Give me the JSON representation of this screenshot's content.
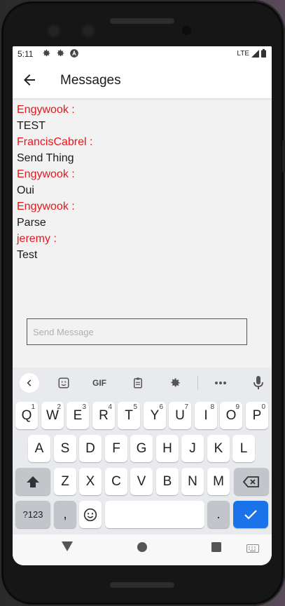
{
  "status": {
    "time": "5:11",
    "network": "LTE"
  },
  "appbar": {
    "title": "Messages"
  },
  "messages": [
    {
      "author": "Engywook :",
      "text": "TEST"
    },
    {
      "author": "FrancisCabrel :",
      "text": "Send Thing"
    },
    {
      "author": "Engywook :",
      "text": "Oui"
    },
    {
      "author": "Engywook :",
      "text": "Parse"
    },
    {
      "author": "jeremy :",
      "text": "Test"
    }
  ],
  "composer": {
    "placeholder": "Send Message",
    "value": ""
  },
  "keyboard": {
    "toolbar": {
      "gif": "GIF"
    },
    "row1": [
      {
        "key": "Q",
        "hint": "1"
      },
      {
        "key": "W",
        "hint": "2"
      },
      {
        "key": "E",
        "hint": "3"
      },
      {
        "key": "R",
        "hint": "4"
      },
      {
        "key": "T",
        "hint": "5"
      },
      {
        "key": "Y",
        "hint": "6"
      },
      {
        "key": "U",
        "hint": "7"
      },
      {
        "key": "I",
        "hint": "8"
      },
      {
        "key": "O",
        "hint": "9"
      },
      {
        "key": "P",
        "hint": "0"
      }
    ],
    "row2": [
      "A",
      "S",
      "D",
      "F",
      "G",
      "H",
      "J",
      "K",
      "L"
    ],
    "row3": [
      "Z",
      "X",
      "C",
      "V",
      "B",
      "N",
      "M"
    ],
    "symbols_label": "?123",
    "comma_label": ",",
    "period_label": "."
  },
  "colors": {
    "author": "#e8161c",
    "accent": "#1a73e8",
    "keyboard_bg": "#e8eaed"
  }
}
